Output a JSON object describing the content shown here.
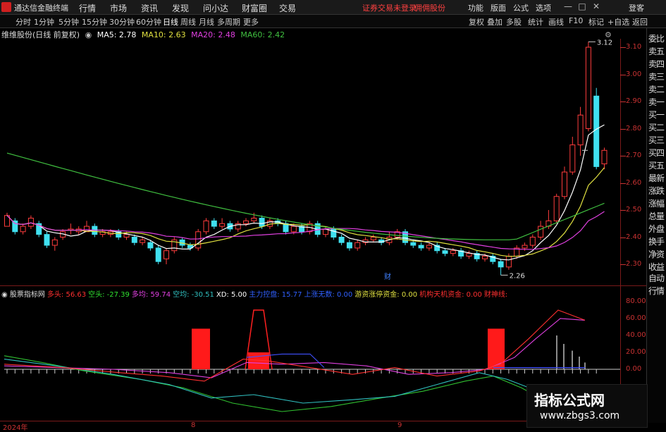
{
  "topbar": {
    "app_name": "通达信金融终端",
    "menus": [
      "行情",
      "市场",
      "资讯",
      "发现",
      "问小达",
      "财富圈",
      "交易"
    ],
    "warning": "证券交易未登录",
    "warning2": "佣佣股份",
    "right_menus": [
      "功能",
      "版面",
      "公式",
      "选项"
    ],
    "right_extra": "登客"
  },
  "tabs": {
    "items": [
      "分时",
      "1分钟",
      "5分钟",
      "15分钟",
      "30分钟",
      "60分钟",
      "日线",
      "周线",
      "月线",
      "多周期",
      "更多"
    ],
    "active_index": 6,
    "right_buttons": [
      "复权",
      "叠加",
      "多股",
      "统计",
      "画线",
      "F10",
      "标记",
      "+自选",
      "返回"
    ]
  },
  "main_info": {
    "stock": "维维股份(日线 前复权)",
    "ma5": "MA5: 2.78",
    "ma10": "MA10: 2.63",
    "ma20": "MA20: 2.48",
    "ma60": "MA60: 2.42",
    "colors": {
      "ma5": "#ffffff",
      "ma10": "#e0e040",
      "ma20": "#e040e0",
      "ma60": "#40c040"
    }
  },
  "price_axis": {
    "ticks": [
      "3.10",
      "3.00",
      "2.90",
      "2.80",
      "2.70",
      "2.60",
      "2.50",
      "2.40",
      "2.30"
    ],
    "high_label": "3.12",
    "low_label": "2.26",
    "marker": "财"
  },
  "right_panel": {
    "items": [
      "委比",
      "卖五",
      "卖四",
      "卖三",
      "卖二",
      "卖一",
      "买一",
      "买二",
      "买三",
      "买四",
      "买五",
      "最新",
      "涨跌",
      "涨幅",
      "总量",
      "外盘",
      "换手",
      "净资",
      "收益"
    ],
    "bottom_items": [
      "自动",
      "行情"
    ]
  },
  "indicator": {
    "name": "股票指标网",
    "fields": [
      {
        "label": "多头:",
        "value": "56.63",
        "color": "#ff3030"
      },
      {
        "label": "空头:",
        "value": "-27.39",
        "color": "#30e030"
      },
      {
        "label": "多均:",
        "value": "59.74",
        "color": "#e040e0"
      },
      {
        "label": "空均:",
        "value": "-30.51",
        "color": "#30c0c0"
      },
      {
        "label": "XD:",
        "value": "5.00",
        "color": "#ffffff"
      },
      {
        "label": "主力控盘:",
        "value": "15.77",
        "color": "#3060ff"
      },
      {
        "label": "上涨无数:",
        "value": "0.00",
        "color": "#3060ff"
      },
      {
        "label": "游资涨停资金:",
        "value": "0.00",
        "color": "#e0e040"
      },
      {
        "label": "机构天机资金:",
        "value": "0.00",
        "color": "#ff3030"
      },
      {
        "label": "财神线:",
        "value": "",
        "color": "#ff3030"
      }
    ],
    "axis": [
      "80.00",
      "60.00",
      "40.00",
      "20.00",
      "0.00"
    ]
  },
  "dates": [
    "2024年",
    "8",
    "9"
  ],
  "watermark": {
    "title": "指标公式网",
    "url": "www.zbgs3.com"
  },
  "chart_data": {
    "type": "candlestick",
    "ylim": [
      2.25,
      3.15
    ],
    "candles": [
      [
        2.44,
        2.48,
        2.49,
        2.44
      ],
      [
        2.46,
        2.42,
        2.47,
        2.41
      ],
      [
        2.42,
        2.44,
        2.45,
        2.41
      ],
      [
        2.44,
        2.47,
        2.48,
        2.43
      ],
      [
        2.45,
        2.41,
        2.46,
        2.4
      ],
      [
        2.41,
        2.37,
        2.42,
        2.36
      ],
      [
        2.37,
        2.39,
        2.4,
        2.35
      ],
      [
        2.4,
        2.42,
        2.43,
        2.39
      ],
      [
        2.43,
        2.43,
        2.45,
        2.41
      ],
      [
        2.42,
        2.43,
        2.44,
        2.41
      ],
      [
        2.42,
        2.44,
        2.46,
        2.42
      ],
      [
        2.44,
        2.41,
        2.45,
        2.4
      ],
      [
        2.41,
        2.42,
        2.43,
        2.4
      ],
      [
        2.41,
        2.42,
        2.43,
        2.4
      ],
      [
        2.42,
        2.4,
        2.43,
        2.39
      ],
      [
        2.4,
        2.41,
        2.42,
        2.39
      ],
      [
        2.4,
        2.38,
        2.41,
        2.37
      ],
      [
        2.38,
        2.39,
        2.4,
        2.37
      ],
      [
        2.38,
        2.36,
        2.39,
        2.35
      ],
      [
        2.36,
        2.31,
        2.37,
        2.3
      ],
      [
        2.32,
        2.35,
        2.36,
        2.3
      ],
      [
        2.35,
        2.39,
        2.4,
        2.34
      ],
      [
        2.39,
        2.37,
        2.4,
        2.36
      ],
      [
        2.37,
        2.36,
        2.38,
        2.35
      ],
      [
        2.36,
        2.42,
        2.43,
        2.35
      ],
      [
        2.42,
        2.46,
        2.47,
        2.41
      ],
      [
        2.46,
        2.44,
        2.47,
        2.43
      ],
      [
        2.44,
        2.45,
        2.47,
        2.43
      ],
      [
        2.45,
        2.43,
        2.46,
        2.42
      ],
      [
        2.43,
        2.45,
        2.46,
        2.42
      ],
      [
        2.45,
        2.46,
        2.47,
        2.44
      ],
      [
        2.46,
        2.47,
        2.49,
        2.45
      ],
      [
        2.47,
        2.44,
        2.48,
        2.43
      ],
      [
        2.44,
        2.46,
        2.47,
        2.43
      ],
      [
        2.46,
        2.45,
        2.47,
        2.44
      ],
      [
        2.45,
        2.42,
        2.46,
        2.41
      ],
      [
        2.42,
        2.44,
        2.45,
        2.41
      ],
      [
        2.44,
        2.42,
        2.45,
        2.41
      ],
      [
        2.42,
        2.45,
        2.46,
        2.41
      ],
      [
        2.45,
        2.41,
        2.46,
        2.4
      ],
      [
        2.41,
        2.43,
        2.44,
        2.4
      ],
      [
        2.43,
        2.4,
        2.44,
        2.39
      ],
      [
        2.4,
        2.38,
        2.41,
        2.37
      ],
      [
        2.38,
        2.36,
        2.39,
        2.35
      ],
      [
        2.36,
        2.38,
        2.39,
        2.35
      ],
      [
        2.38,
        2.39,
        2.4,
        2.37
      ],
      [
        2.39,
        2.4,
        2.41,
        2.38
      ],
      [
        2.39,
        2.38,
        2.4,
        2.37
      ],
      [
        2.38,
        2.4,
        2.42,
        2.37
      ],
      [
        2.4,
        2.42,
        2.43,
        2.39
      ],
      [
        2.42,
        2.38,
        2.43,
        2.37
      ],
      [
        2.38,
        2.37,
        2.39,
        2.36
      ],
      [
        2.37,
        2.36,
        2.38,
        2.35
      ],
      [
        2.36,
        2.37,
        2.38,
        2.35
      ],
      [
        2.37,
        2.35,
        2.38,
        2.34
      ],
      [
        2.35,
        2.34,
        2.36,
        2.33
      ],
      [
        2.34,
        2.35,
        2.36,
        2.33
      ],
      [
        2.35,
        2.33,
        2.36,
        2.32
      ],
      [
        2.33,
        2.34,
        2.35,
        2.32
      ],
      [
        2.34,
        2.32,
        2.35,
        2.31
      ],
      [
        2.32,
        2.33,
        2.34,
        2.31
      ],
      [
        2.33,
        2.31,
        2.34,
        2.3
      ],
      [
        2.31,
        2.29,
        2.32,
        2.26
      ],
      [
        2.29,
        2.33,
        2.34,
        2.28
      ],
      [
        2.33,
        2.36,
        2.37,
        2.32
      ],
      [
        2.36,
        2.37,
        2.38,
        2.35
      ],
      [
        2.37,
        2.4,
        2.41,
        2.36
      ],
      [
        2.4,
        2.44,
        2.46,
        2.39
      ],
      [
        2.44,
        2.46,
        2.5,
        2.43
      ],
      [
        2.46,
        2.55,
        2.56,
        2.45
      ],
      [
        2.55,
        2.64,
        2.66,
        2.54
      ],
      [
        2.64,
        2.74,
        2.77,
        2.63
      ],
      [
        2.74,
        2.85,
        2.88,
        2.7
      ],
      [
        2.8,
        3.1,
        3.12,
        2.79
      ],
      [
        2.92,
        2.66,
        2.95,
        2.65
      ],
      [
        2.67,
        2.72,
        2.73,
        2.65
      ]
    ],
    "ma_series": [
      "MA5",
      "MA10",
      "MA20",
      "MA60"
    ]
  }
}
